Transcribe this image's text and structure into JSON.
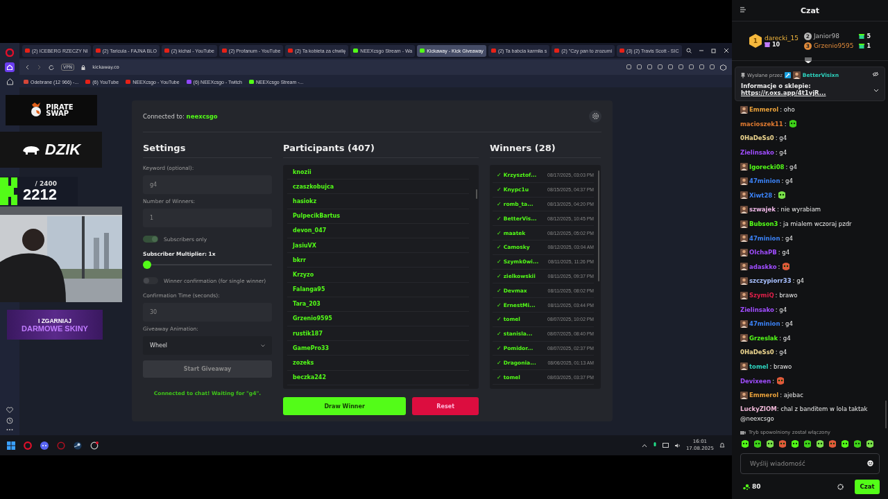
{
  "browser": {
    "tabs": [
      {
        "title": "(2) ICEBERG RZECZY NI",
        "kind": "youtube",
        "selected": false
      },
      {
        "title": "(2) Taricula - FAJNA BLO",
        "kind": "youtube",
        "selected": false
      },
      {
        "title": "(2) kichal - YouTube",
        "kind": "youtube",
        "selected": false
      },
      {
        "title": "(2) Profanum - YouTube",
        "kind": "youtube",
        "selected": false
      },
      {
        "title": "(2) Ta kobieta za chwilę",
        "kind": "youtube",
        "selected": false
      },
      {
        "title": "NEEXcsgo Stream - Wa",
        "kind": "kick",
        "selected": false
      },
      {
        "title": "Kickaway - Kick Giveaway",
        "kind": "kick",
        "selected": true
      },
      {
        "title": "(2) Ta babcia karmiła s",
        "kind": "youtube",
        "selected": false
      },
      {
        "title": "(2) \"Czy pan to zrozumi",
        "kind": "youtube",
        "selected": false
      },
      {
        "title": "(3) (2) Travis Scott - SIC",
        "kind": "youtube",
        "selected": false
      }
    ],
    "vpn": "VPN",
    "url": "kickaway.co",
    "bookmarks": [
      {
        "title": "Odebrane (12 966) -...",
        "kind": "mail"
      },
      {
        "title": "(6) YouTube",
        "kind": "youtube"
      },
      {
        "title": "NEEXcsgo - YouTube",
        "kind": "youtube"
      },
      {
        "title": "(6) NEEXcsgo - Twitch",
        "kind": "twitch"
      },
      {
        "title": "NEEXcsgo Stream -...",
        "kind": "kick"
      }
    ]
  },
  "overlays": {
    "logo": [
      "PIRATE",
      "SWAP"
    ],
    "sponsor": "DZIK",
    "counter": {
      "goal": "/ 2400",
      "value": "2212"
    },
    "webcam": {
      "kind": "picture"
    },
    "banner": [
      "I ZGARNIAJ",
      "DARMOWE SKINY"
    ]
  },
  "app": {
    "connected_label": "Connected to:",
    "channel": "neexcsgo",
    "settings": {
      "title": "Settings",
      "keyword": {
        "label": "Keyword (optional):",
        "value": "g4"
      },
      "winners": {
        "label": "Number of Winners:",
        "value": "1"
      },
      "subscribers_only": {
        "label": "Subscribers only",
        "on": true
      },
      "multiplier": {
        "label": "Subscriber Multiplier: 1x",
        "level": 0
      },
      "confirmation": {
        "label": "Winner confirmation (for single winner)",
        "on": false
      },
      "confirmation_time": {
        "label": "Confirmation Time (seconds):",
        "value": "30"
      },
      "animation": {
        "label": "Giveaway Animation:",
        "value": "Wheel"
      },
      "start_button": "Start Giveaway",
      "status": "Connected to chat! Waiting for \"g4\"."
    },
    "participants": {
      "title": "Participants (407)",
      "names": [
        "knozii",
        "czaszkobujca",
        "hasiokz",
        "PulpecikBartus",
        "devon_047",
        "JasiuVX",
        "bkrr",
        "Krzyzo",
        "Falanga95",
        "Tara_203",
        "Grzenio9595",
        "rustik187",
        "GamePro33",
        "zozeks",
        "beczka242"
      ]
    },
    "draw_button": "Draw Winner",
    "reset_button": "Reset",
    "winners": {
      "title": "Winners (28)",
      "items": [
        {
          "mark": "✓",
          "name": "Krzysztof...",
          "date": "08/17/2025, 03:03 PM"
        },
        {
          "mark": "✓",
          "name": "Knypc1u",
          "date": "08/15/2025, 04:37 PM"
        },
        {
          "mark": "✓",
          "name": "romb_ta...",
          "date": "08/13/2025, 04:20 PM"
        },
        {
          "mark": "✓",
          "name": "BetterVis...",
          "date": "08/12/2025, 10:45 PM"
        },
        {
          "mark": "✓",
          "name": "maatek",
          "date": "08/12/2025, 05:02 PM"
        },
        {
          "mark": "✓",
          "name": "Camosky",
          "date": "08/12/2025, 03:04 AM"
        },
        {
          "mark": "✓",
          "name": "Szymk0wi...",
          "date": "08/11/2025, 11:26 PM"
        },
        {
          "mark": "✓",
          "name": "zielkowskii",
          "date": "08/11/2025, 09:37 PM"
        },
        {
          "mark": "✓",
          "name": "Devmax",
          "date": "08/11/2025, 08:02 PM"
        },
        {
          "mark": "✓",
          "name": "ErnestMi...",
          "date": "08/11/2025, 03:44 PM"
        },
        {
          "mark": "✓",
          "name": "tomel",
          "date": "08/07/2025, 10:02 PM"
        },
        {
          "mark": "✓",
          "name": "stanisla...",
          "date": "08/07/2025, 08:40 PM"
        },
        {
          "mark": "✓",
          "name": "Pomidor...",
          "date": "08/07/2025, 02:37 PM"
        },
        {
          "mark": "✓",
          "name": "Dragonia...",
          "date": "08/06/2025, 01:13 AM"
        },
        {
          "mark": "✓",
          "name": "tomel",
          "date": "08/03/2025, 03:37 PM"
        }
      ]
    }
  },
  "taskbar": {
    "time": "16:01",
    "date": "17.08.2025"
  },
  "chat": {
    "title": "Czat",
    "leaders": [
      {
        "rank": "1",
        "name": "darecki_15",
        "gifts": "10",
        "color": "#f5b83d"
      },
      {
        "rank": "2",
        "name": "Janior98",
        "gifts": "5",
        "color": "#b8b8b8"
      },
      {
        "rank": "3",
        "name": "Grzenio9595",
        "gifts": "1",
        "color": "#e08a3a"
      }
    ],
    "pinned": {
      "sent_by": "Wysłane przez",
      "author": "BetterVisixn",
      "title": "Informacje o sklepie:",
      "link": "https://r.oxs.app/4t1vjR..."
    },
    "messages": [
      {
        "name": "Emmerol",
        "color": "#e8a03a",
        "avatar": true,
        "kind": "text",
        "text": ": oho"
      },
      {
        "name": "macioszek11",
        "color": "#e07a30",
        "avatar": false,
        "kind": "emote",
        "text": ":"
      },
      {
        "name": "0HaDeSs0",
        "color": "#f0d890",
        "avatar": false,
        "kind": "text",
        "text": ": g4"
      },
      {
        "name": "Zielinsako",
        "color": "#a04dff",
        "avatar": false,
        "kind": "text",
        "text": ": g4"
      },
      {
        "name": "Igorecki08",
        "color": "#53fc18",
        "avatar": true,
        "kind": "text",
        "text": ": g4"
      },
      {
        "name": "47minion",
        "color": "#3b82f6",
        "avatar": true,
        "kind": "text",
        "text": ": g4"
      },
      {
        "name": "Xiwt28",
        "color": "#3b82f6",
        "avatar": true,
        "kind": "emote",
        "text": ":"
      },
      {
        "name": "szwajek",
        "color": "#f0b8e8",
        "avatar": true,
        "kind": "text",
        "text": ": nie wyrabiam"
      },
      {
        "name": "Bubson3",
        "color": "#53fc18",
        "avatar": true,
        "kind": "text",
        "text": ": ja mialem wczoraj pzdr"
      },
      {
        "name": "47minion",
        "color": "#3b82f6",
        "avatar": true,
        "kind": "text",
        "text": ": g4"
      },
      {
        "name": "OlchaPB",
        "color": "#a04dff",
        "avatar": true,
        "kind": "text",
        "text": ": g4"
      },
      {
        "name": "adaskko",
        "color": "#a04dff",
        "avatar": true,
        "kind": "emote",
        "text": ":"
      },
      {
        "name": "szczypiorr33",
        "color": "#a8c0ff",
        "avatar": true,
        "kind": "text",
        "text": ": g4"
      },
      {
        "name": "SzymiQ",
        "color": "#e0204a",
        "avatar": true,
        "kind": "text",
        "text": ": brawo"
      },
      {
        "name": "Zielinsako",
        "color": "#a04dff",
        "avatar": false,
        "kind": "text",
        "text": ": g4"
      },
      {
        "name": "47minion",
        "color": "#3b82f6",
        "avatar": true,
        "kind": "text",
        "text": ": g4"
      },
      {
        "name": "Grzeslak",
        "color": "#53fc18",
        "avatar": true,
        "kind": "text",
        "text": ": g4"
      },
      {
        "name": "0HaDeSs0",
        "color": "#f0d890",
        "avatar": false,
        "kind": "text",
        "text": ": g4"
      },
      {
        "name": "tomel",
        "color": "#2dd4bf",
        "avatar": true,
        "kind": "text",
        "text": ": brawo"
      },
      {
        "name": "Devixeen",
        "color": "#a04dff",
        "avatar": false,
        "kind": "emote",
        "text": ":"
      },
      {
        "name": "Emmerol",
        "color": "#e8a03a",
        "avatar": true,
        "kind": "text",
        "text": ": ajebac"
      },
      {
        "name": "LuckyZIOM",
        "color": "#f0b8d8",
        "avatar": false,
        "kind": "text",
        "text": ": chal z banditem w lola taktak @neexcsgo"
      }
    ],
    "slow_mode": "Tryb spowolniony został włączony",
    "input": {
      "placeholder": "Wyślij wiadomość"
    },
    "points": "80",
    "send_button": "Czat"
  }
}
